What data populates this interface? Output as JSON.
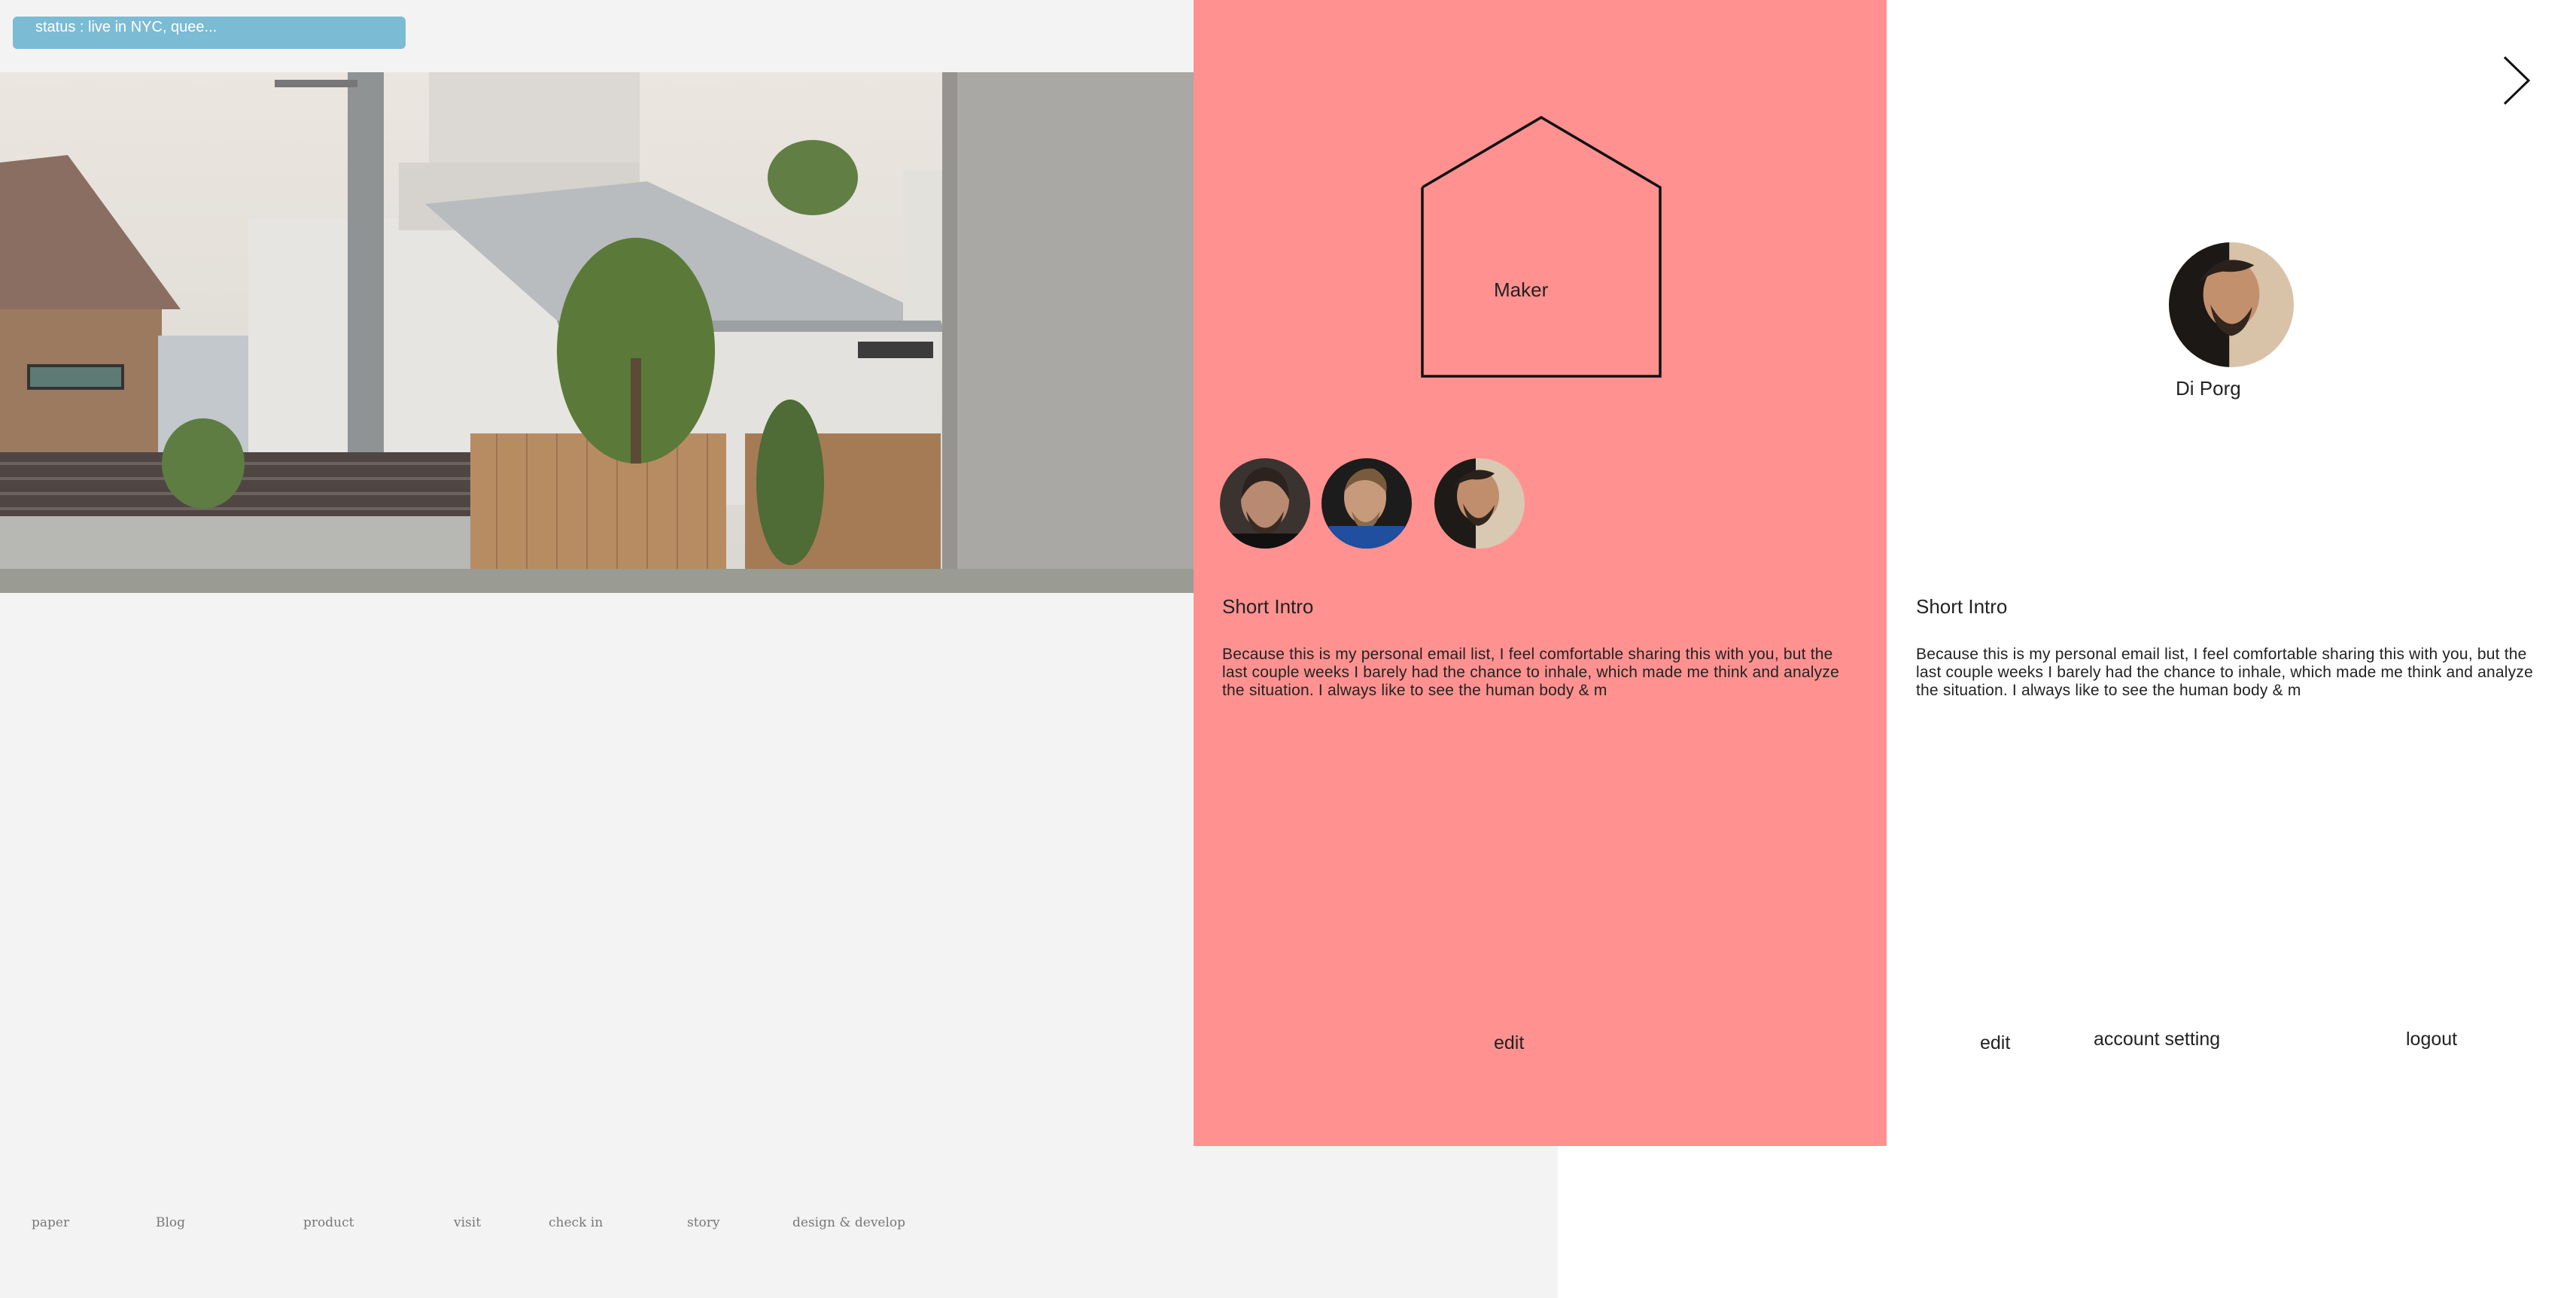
{
  "status": {
    "text": "status : live in NYC, quee..."
  },
  "hero": {
    "image": "house-photo"
  },
  "maker_panel": {
    "house_label": "Maker",
    "avatars": [
      "avatar-1",
      "avatar-2",
      "avatar-3"
    ],
    "intro_title": "Short Intro",
    "intro_text": "Because this is my personal email list, I feel comfortable sharing this with you, but the last couple weeks I barely had the chance to inhale, which made me think and analyze the situation. I always like to see the human body & m",
    "edit_label": "edit"
  },
  "profile_panel": {
    "name": "Di Porg",
    "intro_title": "Short Intro",
    "intro_text": "Because this is my personal email list, I feel comfortable sharing this with you, but the last couple weeks I barely had the chance to inhale, which made me think and analyze the situation. I always like to see the human body & m",
    "edit_label": "edit",
    "account_label": "account setting",
    "logout_label": "logout",
    "next_icon": "chevron-right-icon"
  },
  "footer": {
    "links": [
      "paper",
      "Blog",
      "product",
      "visit",
      "check in",
      "story",
      "design & develop"
    ]
  },
  "colors": {
    "status_bg": "#7bbbd4",
    "maker_bg": "#ff9290",
    "page_bg": "#f3f3f3"
  }
}
